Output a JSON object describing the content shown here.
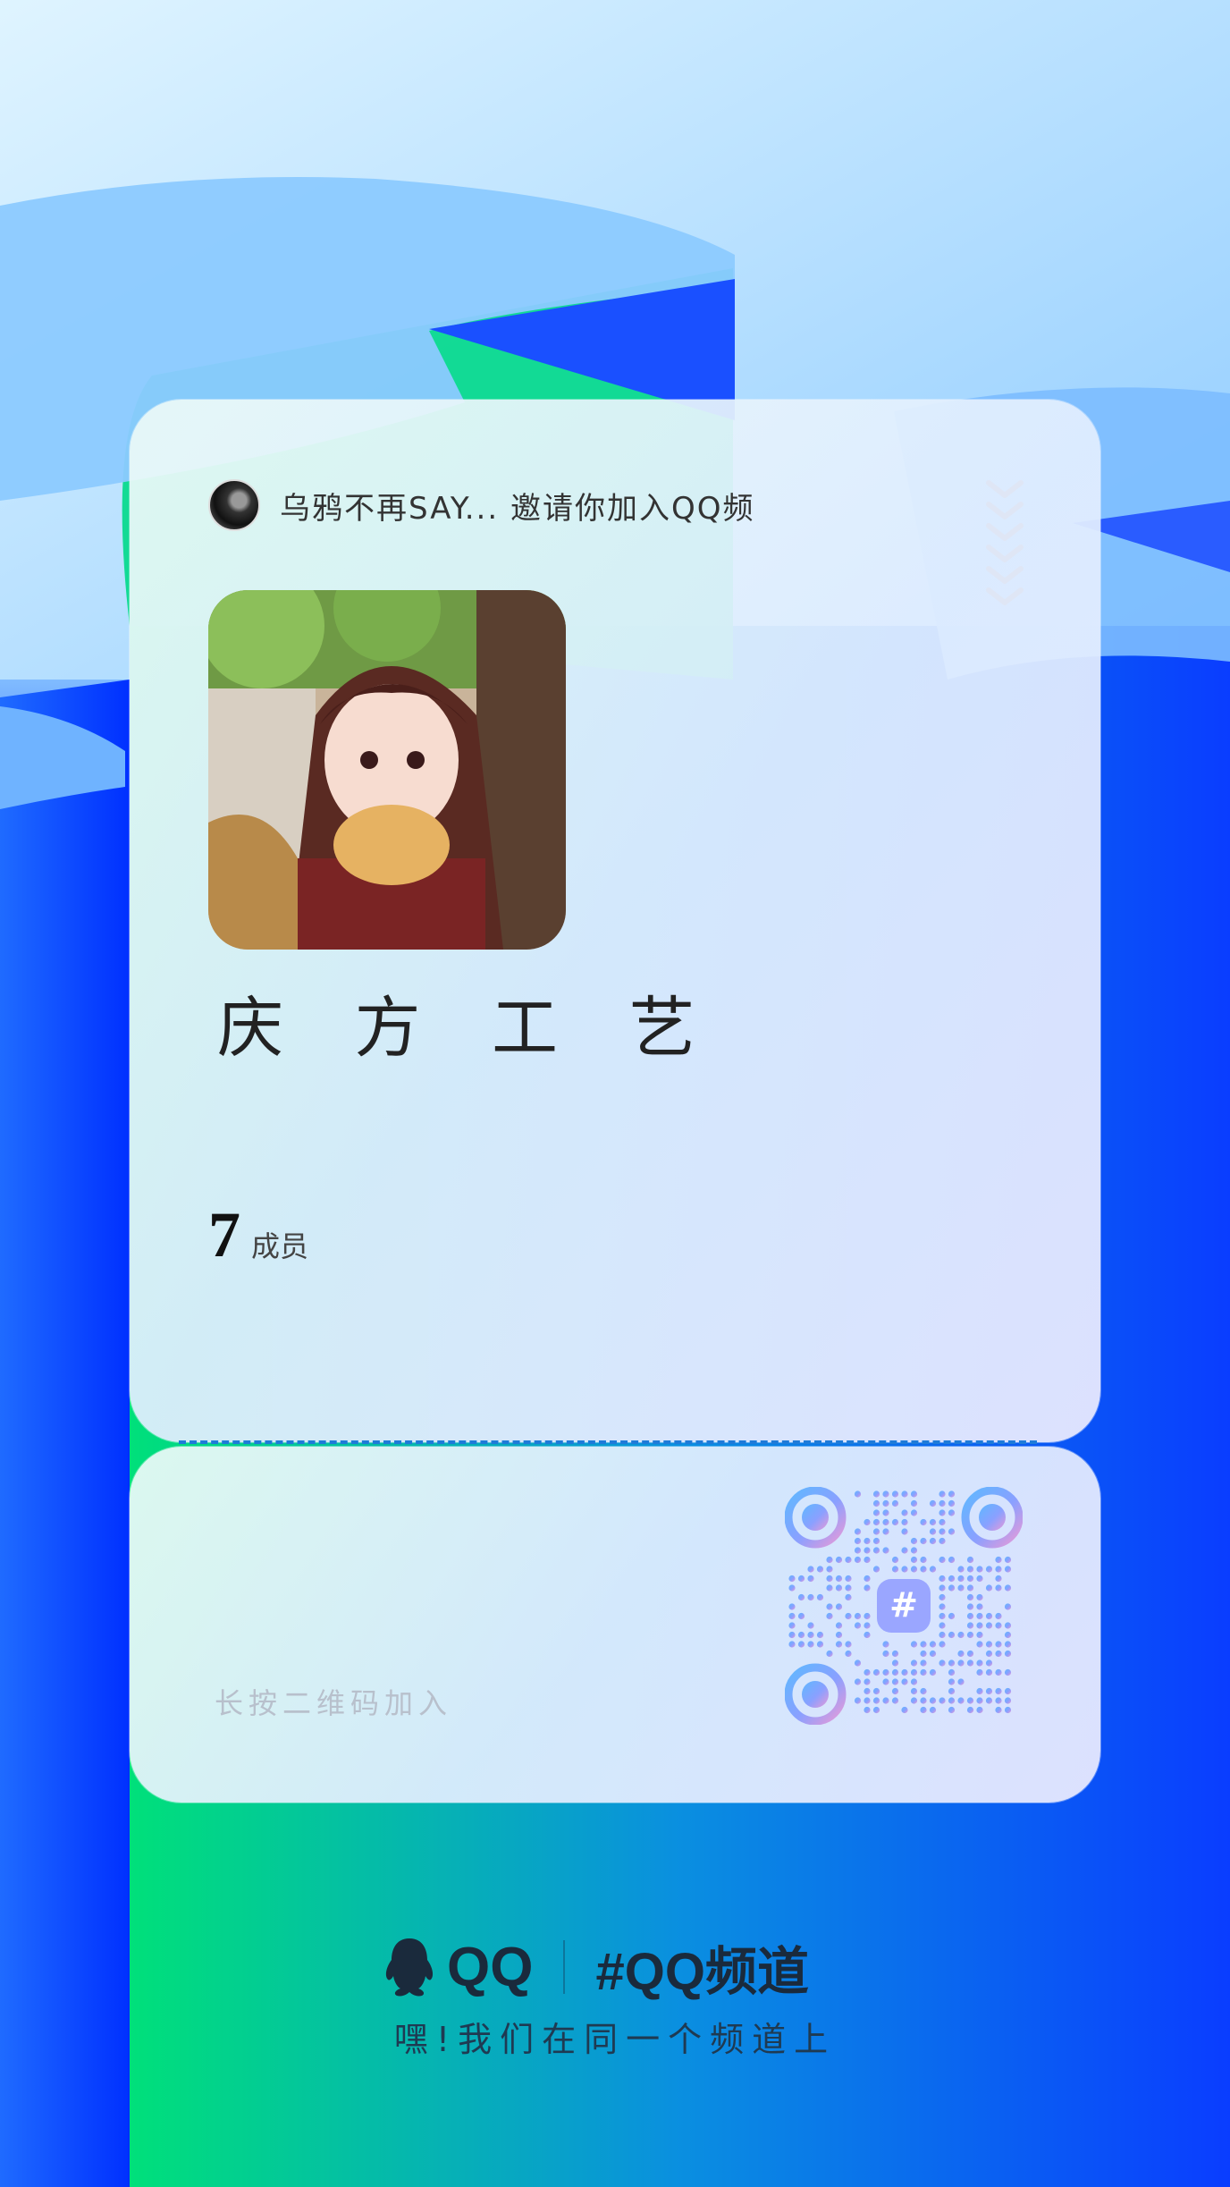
{
  "invite": {
    "text": "乌鸦不再SAY... 邀请你加入QQ频"
  },
  "channel": {
    "name": "庆 方 工 艺",
    "member_count": "7",
    "member_label": "成员"
  },
  "qr_hint": "长按二维码加入",
  "footer": {
    "qq_label": "QQ",
    "channel_brand": "#QQ频道",
    "slogan": "嘿!我们在同一个频道上"
  },
  "colors": {
    "accent_green": "#00e07a",
    "accent_blue": "#0a3dff",
    "tear_line": "#1e7bd9"
  },
  "icons": {
    "chevrons": "chevron-down-stack-icon",
    "qq_penguin": "qq-penguin-icon",
    "qr_center": "hash-icon"
  }
}
